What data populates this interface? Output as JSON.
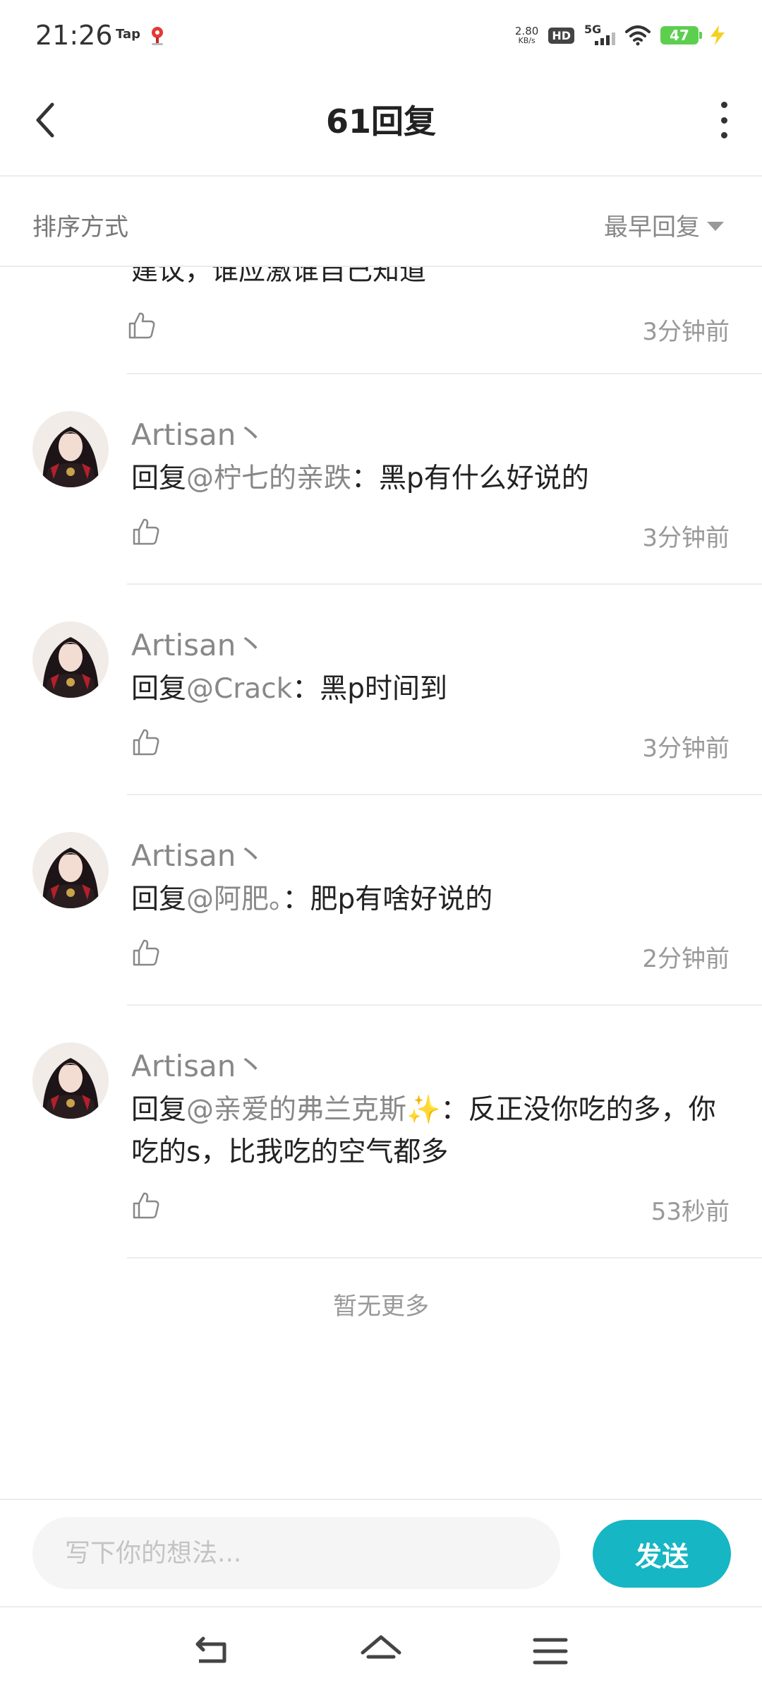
{
  "status_bar": {
    "time": "21:26",
    "tap_label": "Tap",
    "net_speed_value": "2.80",
    "net_speed_unit": "KB/s",
    "hd_label": "HD",
    "network_label": "5G",
    "battery_level": "47",
    "colors": {
      "battery": "#5ccf4f",
      "charging": "#f5d020"
    }
  },
  "header": {
    "title": "61回复",
    "back_icon": "chevron-left-icon",
    "more_icon": "more-vertical-icon"
  },
  "sort": {
    "label": "排序方式",
    "value": "最早回复"
  },
  "partial_reply": {
    "text": "建议，谁应激谁自己知道",
    "time": "3分钟前"
  },
  "replies": [
    {
      "username": "Artisan丶",
      "prefix": "回复",
      "mention": "@柠七的亲跌",
      "separator": "：",
      "text": "黑p有什么好说的",
      "time": "3分钟前"
    },
    {
      "username": "Artisan丶",
      "prefix": "回复",
      "mention": "@Crack",
      "separator": "：",
      "text": "黑p时间到",
      "time": "3分钟前"
    },
    {
      "username": "Artisan丶",
      "prefix": "回复",
      "mention": "@阿肥。",
      "separator": "：",
      "text": "肥p有啥好说的",
      "time": "2分钟前"
    },
    {
      "username": "Artisan丶",
      "prefix": "回复",
      "mention": "@亲爱的弗兰克斯✨",
      "separator": "：",
      "text": "反正没你吃的多，你吃的s，比我吃的空气都多",
      "time": "53秒前"
    }
  ],
  "no_more": "暂无更多",
  "composer": {
    "placeholder": "写下你的想法...",
    "send_label": "发送",
    "accent": "#16b6c4"
  },
  "nav": {
    "back_icon": "nav-back-icon",
    "home_icon": "nav-home-icon",
    "menu_icon": "nav-menu-icon"
  }
}
